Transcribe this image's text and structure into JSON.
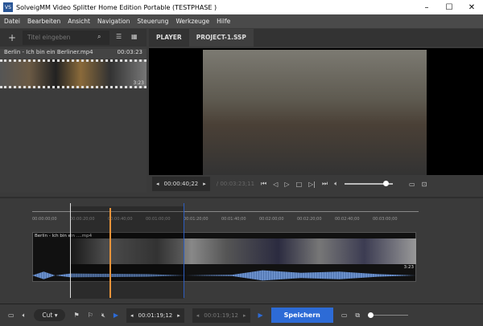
{
  "window": {
    "title": "SolveigMM Video Splitter Home Edition Portable  (TESTPHASE )",
    "logo": "VS"
  },
  "menu": [
    "Datei",
    "Bearbeiten",
    "Ansicht",
    "Navigation",
    "Steuerung",
    "Werkzeuge",
    "Hilfe"
  ],
  "library": {
    "search_placeholder": "Titel eingeben",
    "file_name": "Berlin - Ich bin ein Berliner.mp4",
    "duration": "00:03:23",
    "thumb_duration": "3:23"
  },
  "tabs": [
    {
      "label": "PLAYER"
    },
    {
      "label": "PROJECT-1.SSP"
    }
  ],
  "player": {
    "current_time": "00:00:40;22",
    "total_time": "/ 00:03:23;11",
    "volume": 0.85
  },
  "timeline": {
    "ticks": [
      "00:00:00;00",
      "00:00:20;00",
      "00:00:40;00",
      "00:01:00;00",
      "00:01:20;00",
      "00:01:40;00",
      "00:02:00;00",
      "00:02:20;00",
      "00:02:40;00",
      "00:03:00;00"
    ],
    "clip_label": "Berlin - Ich bin ein ....mp4",
    "clip_duration": "3:23",
    "accent": "#e8943a"
  },
  "bottom": {
    "mode": "Cut",
    "start_time": "00:01:19;12",
    "end_time": "00:01:19;12",
    "save_label": "Speichern",
    "save_color": "#2d6bd6"
  }
}
